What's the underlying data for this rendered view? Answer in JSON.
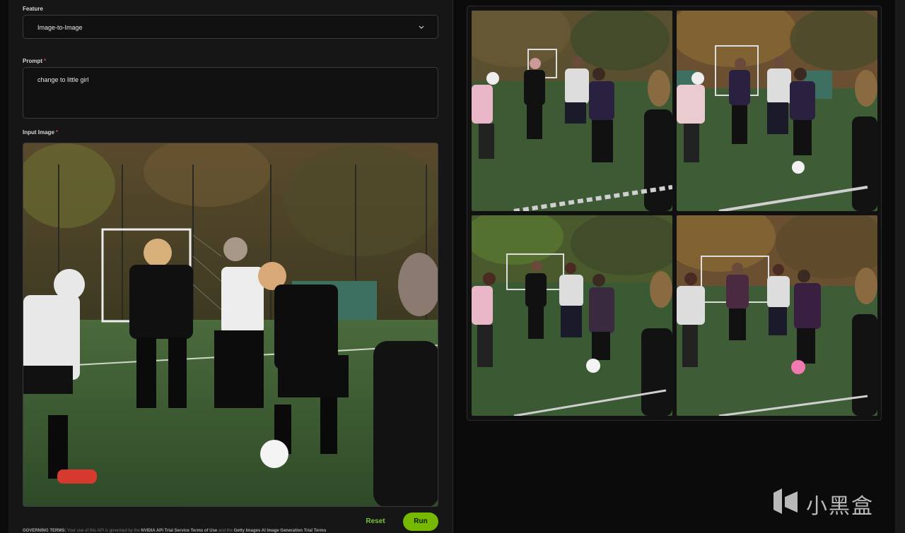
{
  "form": {
    "feature_label": "Feature",
    "feature_value": "Image-to-Image",
    "prompt_label": "Prompt",
    "prompt_value": "change to little girl",
    "input_image_label": "Input Image",
    "required_mark": "*"
  },
  "actions": {
    "reset_label": "Reset",
    "run_label": "Run"
  },
  "terms": {
    "prefix": "GOVERNING TERMS:",
    "text1": " Your use of this API is governed by the ",
    "link1": "NVIDIA API Trial Service Terms of Use",
    "text2": " and the ",
    "link2": "Getty Images AI Image Generation Trial Terms"
  },
  "output": {
    "images": [
      "generated-image-1",
      "generated-image-2",
      "generated-image-3",
      "generated-image-4"
    ]
  },
  "watermark": {
    "text": "小黑盒"
  },
  "colors": {
    "accent": "#76b900",
    "panel": "#161617",
    "background": "#0b0b0c",
    "required": "#e0424d"
  }
}
